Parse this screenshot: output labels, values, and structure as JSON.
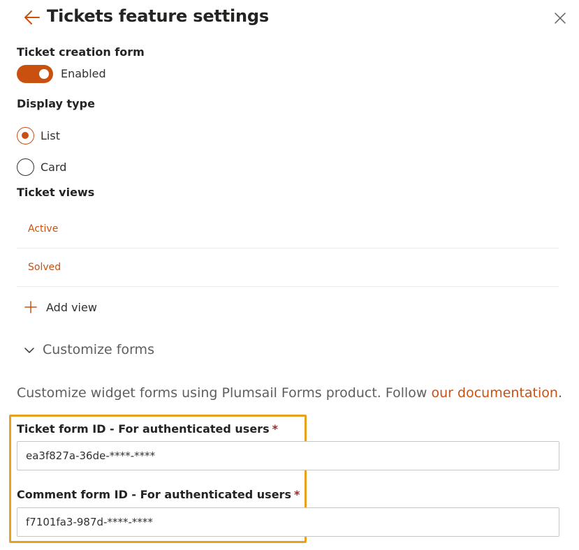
{
  "header": {
    "title": "Tickets feature settings",
    "back_icon": "arrow-left-icon",
    "close_icon": "close-icon"
  },
  "ticket_creation": {
    "label": "Ticket creation form",
    "toggle_state": true,
    "toggle_text": "Enabled"
  },
  "display_type": {
    "label": "Display type",
    "options": [
      {
        "label": "List",
        "selected": true
      },
      {
        "label": "Card",
        "selected": false
      }
    ]
  },
  "ticket_views": {
    "label": "Ticket views",
    "items": [
      {
        "label": "Active"
      },
      {
        "label": "Solved"
      }
    ],
    "add_label": "Add view"
  },
  "customize": {
    "label": "Customize forms",
    "help_text": "Customize widget forms using Plumsail Forms product. Follow ",
    "link_text": "our documentation",
    "help_suffix": "."
  },
  "fields": [
    {
      "label": "Ticket form ID - For authenticated users",
      "required_mark": "*",
      "value": "ea3f827a-36de-****-****"
    },
    {
      "label": "Comment form ID - For authenticated users",
      "required_mark": "*",
      "value": "f7101fa3-987d-****-****"
    }
  ],
  "colors": {
    "accent": "#ca5010",
    "highlight_border": "#e8a020",
    "required": "#a4262c"
  }
}
